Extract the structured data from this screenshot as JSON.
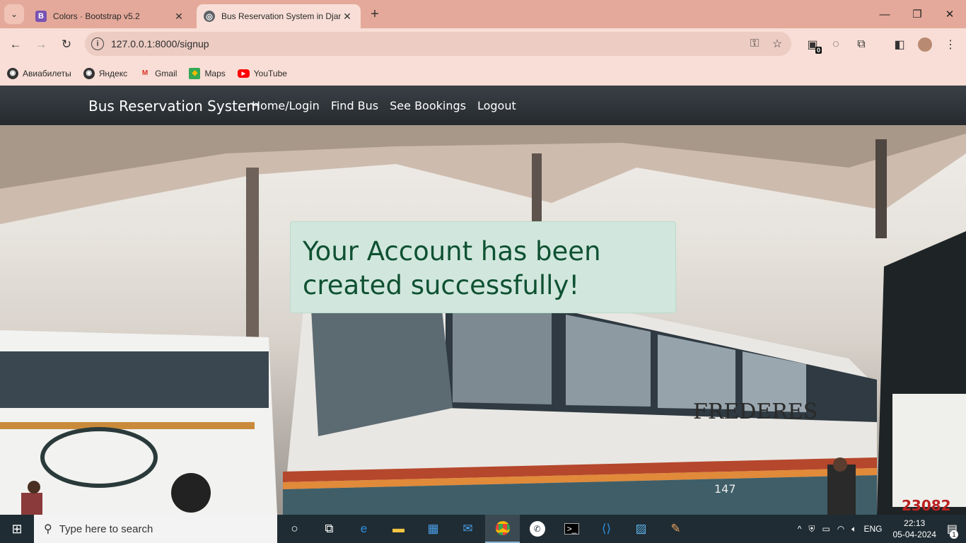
{
  "browser": {
    "tabs": [
      {
        "favicon": "B",
        "title": "Colors · Bootstrap v5.2",
        "active": false
      },
      {
        "favicon": "globe",
        "title": "Bus Reservation System in Djan",
        "active": true
      }
    ],
    "url": "127.0.0.1:8000/signup",
    "bookmarks": [
      {
        "label": "Авиабилеты",
        "icon": "globe-icon"
      },
      {
        "label": "Яндекс",
        "icon": "globe-icon"
      },
      {
        "label": "Gmail",
        "icon": "gmail-icon"
      },
      {
        "label": "Maps",
        "icon": "maps-icon"
      },
      {
        "label": "YouTube",
        "icon": "youtube-icon"
      }
    ],
    "extension_badge": "0"
  },
  "site": {
    "brand": "Bus Reservation System",
    "nav": [
      "Home/Login",
      "Find Bus",
      "See Bookings",
      "Logout"
    ],
    "alert": "Your Account has been created successfully!",
    "hero_bus_text": "FREDERES",
    "hero_bus_number": "23082",
    "hero_bus_side_number": "147"
  },
  "taskbar": {
    "search_placeholder": "Type here to search",
    "language": "ENG",
    "time": "22:13",
    "date": "05-04-2024",
    "notification_count": "1"
  },
  "colors": {
    "tabstrip": "#e4a99a",
    "toolbar": "#f8ded6",
    "navbar": "#2c3034",
    "alert_bg": "#d1e7dd",
    "alert_text": "#0f5132"
  }
}
